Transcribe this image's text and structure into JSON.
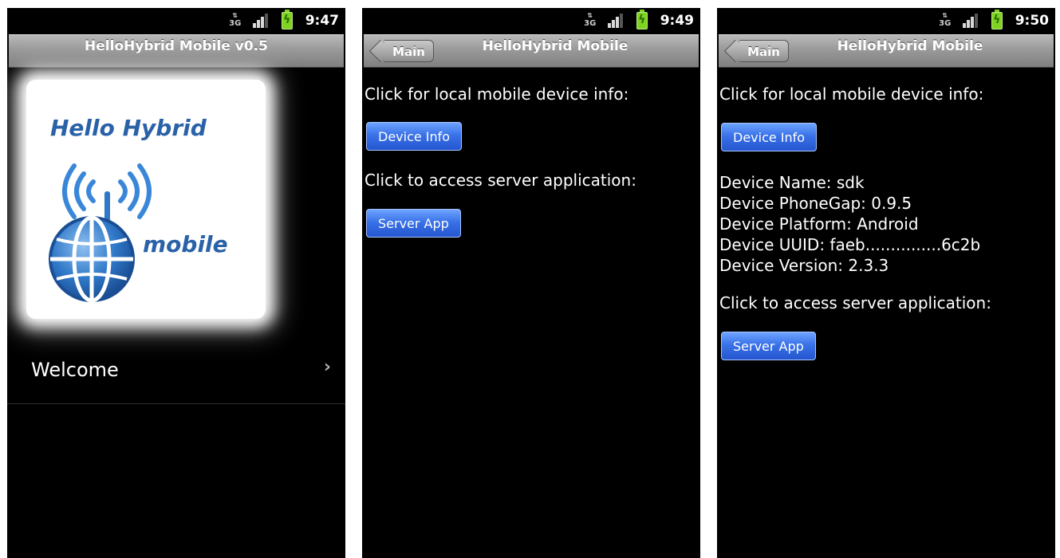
{
  "screens": [
    {
      "status": {
        "time": "9:47"
      },
      "title": "HelloHybrid Mobile v0.5",
      "logo": {
        "line1": "Hello Hybrid",
        "line2": "mobile"
      },
      "list": [
        {
          "label": "Welcome"
        }
      ]
    },
    {
      "status": {
        "time": "9:49"
      },
      "back_label": "Main",
      "title": "HelloHybrid Mobile",
      "local_prompt": "Click for local mobile device info:",
      "device_info_button": "Device Info",
      "server_prompt": "Click to access server application:",
      "server_app_button": "Server App"
    },
    {
      "status": {
        "time": "9:50"
      },
      "back_label": "Main",
      "title": "HelloHybrid Mobile",
      "local_prompt": "Click for local mobile device info:",
      "device_info_button": "Device Info",
      "device_details": [
        "Device Name: sdk",
        "Device PhoneGap: 0.9.5",
        "Device Platform: Android",
        "Device UUID: faeb...............6c2b",
        "Device Version: 2.3.3"
      ],
      "server_prompt": "Click to access server application:",
      "server_app_button": "Server App"
    }
  ],
  "status_icons": {
    "network": "3G",
    "net_icon": "network-3g-icon",
    "signal_icon": "signal-icon",
    "battery_icon": "battery-charging-icon"
  },
  "colors": {
    "button_blue": "#3a72e8",
    "titlebar_gray": "#9a9a9a",
    "logo_blue": "#2a62a8",
    "battery_green": "#7ed321"
  }
}
